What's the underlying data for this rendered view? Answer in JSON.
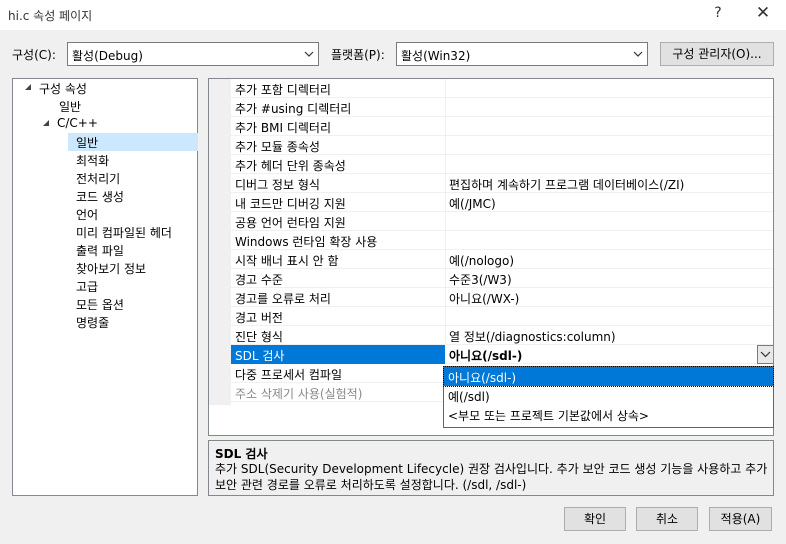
{
  "window": {
    "title": "hi.c 속성 페이지",
    "help_glyph": "?",
    "close_glyph": "✕"
  },
  "toolbar": {
    "config_label": "구성(C):",
    "config_value": "활성(Debug)",
    "platform_label": "플랫폼(P):",
    "platform_value": "활성(Win32)",
    "config_manager_label": "구성 관리자(O)..."
  },
  "tree": {
    "items": [
      {
        "label": "구성 속성"
      },
      {
        "label": "일반"
      },
      {
        "label": "C/C++"
      },
      {
        "label": "일반"
      },
      {
        "label": "최적화"
      },
      {
        "label": "전처리기"
      },
      {
        "label": "코드 생성"
      },
      {
        "label": "언어"
      },
      {
        "label": "미리 컴파일된 헤더"
      },
      {
        "label": "출력 파일"
      },
      {
        "label": "찾아보기 정보"
      },
      {
        "label": "고급"
      },
      {
        "label": "모든 옵션"
      },
      {
        "label": "명령줄"
      }
    ],
    "selected": "일반"
  },
  "grid": {
    "rows": [
      {
        "name": "추가 포함 디렉터리",
        "value": ""
      },
      {
        "name": "추가 #using 디렉터리",
        "value": ""
      },
      {
        "name": "추가 BMI 디렉터리",
        "value": ""
      },
      {
        "name": "추가 모듈 종속성",
        "value": ""
      },
      {
        "name": "추가 헤더 단위 종속성",
        "value": ""
      },
      {
        "name": "디버그 정보 형식",
        "value": "편집하며 계속하기 프로그램 데이터베이스(/ZI)"
      },
      {
        "name": "내 코드만 디버깅 지원",
        "value": "예(/JMC)"
      },
      {
        "name": "공용 언어 런타임 지원",
        "value": ""
      },
      {
        "name": "Windows 런타임 확장 사용",
        "value": ""
      },
      {
        "name": "시작 배너 표시 안 함",
        "value": "예(/nologo)"
      },
      {
        "name": "경고 수준",
        "value": "수준3(/W3)"
      },
      {
        "name": "경고를 오류로 처리",
        "value": "아니요(/WX-)"
      },
      {
        "name": "경고 버전",
        "value": ""
      },
      {
        "name": "진단 형식",
        "value": "열 정보(/diagnostics:column)"
      },
      {
        "name": "SDL 검사",
        "value": "아니요(/sdl-)"
      },
      {
        "name": "다중 프로세서 컴파일",
        "value": ""
      },
      {
        "name": "주소 삭제기 사용(실험적)",
        "value": ""
      }
    ],
    "selected_row": "SDL 검사"
  },
  "dropdown": {
    "options": [
      "아니요(/sdl-)",
      "예(/sdl)",
      "<부모 또는 프로젝트 기본값에서 상속>"
    ],
    "highlighted": "아니요(/sdl-)"
  },
  "description": {
    "title": "SDL 검사",
    "text": "추가 SDL(Security Development Lifecycle) 권장 검사입니다. 추가 보안 코드 생성 기능을 사용하고 추가 보안 관련 경로를 오류로 처리하도록 설정합니다. (/sdl, /sdl-)"
  },
  "buttons": {
    "ok": "확인",
    "cancel": "취소",
    "apply": "적용(A)"
  },
  "colors": {
    "selection_blue": "#0078d7",
    "tree_selection": "#cce8ff"
  }
}
